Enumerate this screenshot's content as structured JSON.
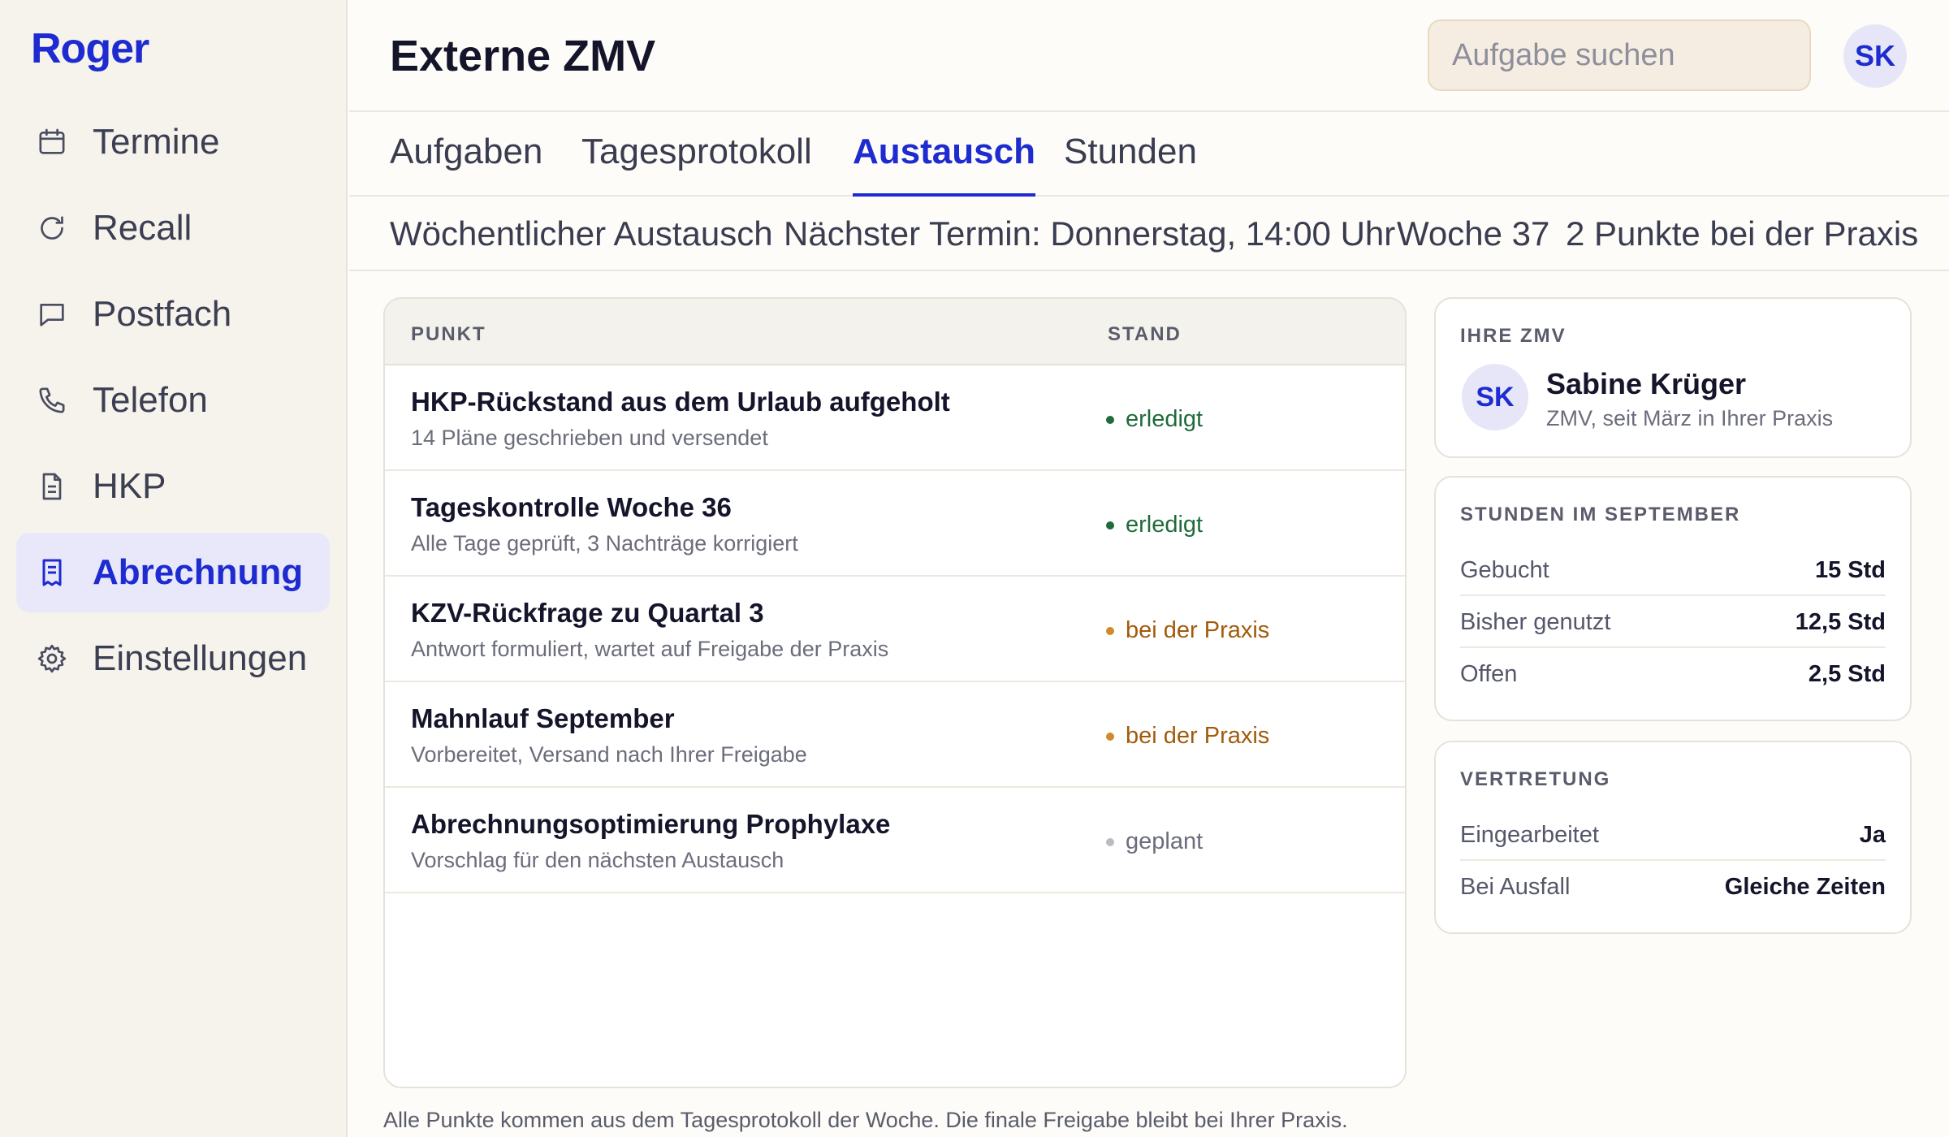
{
  "app": {
    "logo": "Roger"
  },
  "sidebar": {
    "items": [
      {
        "label": "Termine",
        "icon": "calendar-icon"
      },
      {
        "label": "Recall",
        "icon": "refresh-icon"
      },
      {
        "label": "Postfach",
        "icon": "message-icon"
      },
      {
        "label": "Telefon",
        "icon": "phone-icon"
      },
      {
        "label": "HKP",
        "icon": "document-icon"
      },
      {
        "label": "Abrechnung",
        "icon": "receipt-icon",
        "active": true
      },
      {
        "label": "Einstellungen",
        "icon": "gear-icon"
      }
    ]
  },
  "header": {
    "title": "Externe ZMV",
    "search_placeholder": "Aufgabe suchen",
    "user_initials": "SK"
  },
  "tabs": [
    {
      "label": "Aufgaben"
    },
    {
      "label": "Tagesprotokoll"
    },
    {
      "label": "Austausch",
      "active": true
    },
    {
      "label": "Stunden"
    }
  ],
  "subbar": {
    "title": "Wöchentlicher Austausch",
    "next_meeting": "Nächster Termin: Donnerstag, 14:00 Uhr",
    "week": "Woche 37",
    "open_points": "2 Punkte bei der Praxis"
  },
  "table": {
    "columns": [
      "PUNKT",
      "STAND"
    ],
    "rows": [
      {
        "title": "HKP-Rückstand aus dem Urlaub aufgeholt",
        "subtitle": "14 Pläne geschrieben und versendet",
        "status": "erledigt",
        "status_color": "#1f6b3a",
        "dot_color": "#1f6b3a"
      },
      {
        "title": "Tageskontrolle Woche 36",
        "subtitle": "Alle Tage geprüft, 3 Nachträge korrigiert",
        "status": "erledigt",
        "status_color": "#1f6b3a",
        "dot_color": "#1f6b3a"
      },
      {
        "title": "KZV-Rückfrage zu Quartal 3",
        "subtitle": "Antwort formuliert, wartet auf Freigabe der Praxis",
        "status": "bei der Praxis",
        "status_color": "#a35a0c",
        "dot_color": "#d08a2a"
      },
      {
        "title": "Mahnlauf September",
        "subtitle": "Vorbereitet, Versand nach Ihrer Freigabe",
        "status": "bei der Praxis",
        "status_color": "#a35a0c",
        "dot_color": "#d08a2a"
      },
      {
        "title": "Abrechnungsoptimierung Prophylaxe",
        "subtitle": "Vorschlag für den nächsten Austausch",
        "status": "geplant",
        "status_color": "#6b6d7b",
        "dot_color": "#b9bac4"
      }
    ],
    "footnote": "Alle Punkte kommen aus dem Tagesprotokoll der Woche. Die finale Freigabe bleibt bei Ihrer Praxis."
  },
  "zmv_card": {
    "label": "IHRE ZMV",
    "initials": "SK",
    "name": "Sabine Krüger",
    "role": "ZMV, seit März in Ihrer Praxis"
  },
  "hours_card": {
    "label": "STUNDEN IM SEPTEMBER",
    "rows": [
      {
        "key": "Gebucht",
        "value": "15 Std"
      },
      {
        "key": "Bisher genutzt",
        "value": "12,5 Std"
      },
      {
        "key": "Offen",
        "value": "2,5 Std"
      }
    ]
  },
  "substitute_card": {
    "label": "VERTRETUNG",
    "rows": [
      {
        "key": "Eingearbeitet",
        "value": "Ja"
      },
      {
        "key": "Bei Ausfall",
        "value": "Gleiche Zeiten"
      }
    ]
  },
  "colors": {
    "accent": "#1d2bd0",
    "sidebar_bg": "#f6f3ec",
    "active_bg": "#e9e8fa",
    "search_bg": "#f5ede1"
  }
}
